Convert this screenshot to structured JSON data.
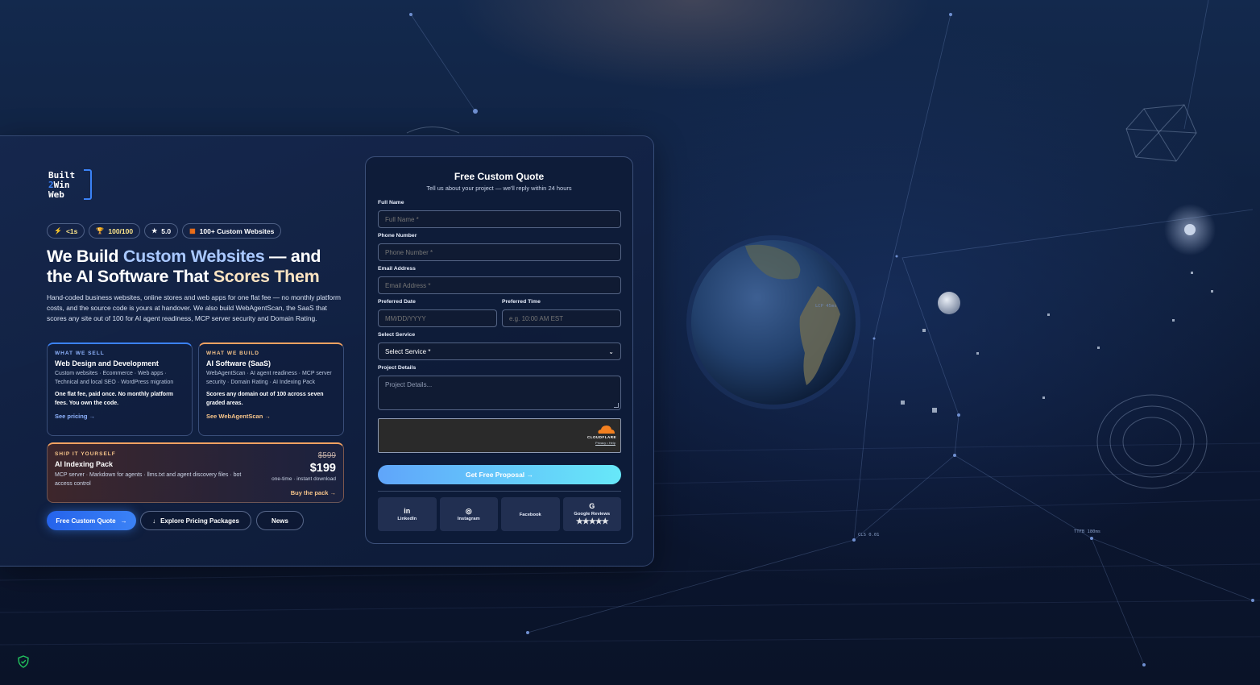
{
  "logo": {
    "line1": "Built",
    "line2_accent": "2",
    "line2": "Win",
    "line3": "Web"
  },
  "badges": [
    {
      "icon": "lightning-icon",
      "glyph": "⚡",
      "label": "<1s"
    },
    {
      "icon": "trophy-icon",
      "glyph": "🏆",
      "label": "100/100"
    },
    {
      "icon": "star-icon",
      "glyph": "★",
      "label": "5.0"
    },
    {
      "icon": "grid-icon",
      "glyph": "▦",
      "label": "100+ Custom Websites"
    }
  ],
  "headline": {
    "p1": "We Build ",
    "hl": "Custom Websites",
    "p2": " — and",
    "p3": "the AI Software That ",
    "p4": "Scores Them"
  },
  "lede": "Hand-coded business websites, online stores and web apps for one flat fee — no monthly platform costs, and the source code is yours at handover. We also build WebAgentScan, the SaaS that scores any site out of 100 for AI agent readiness, MCP server security and Domain Rating.",
  "cards": [
    {
      "eyebrow": "WHAT WE SELL",
      "title": "Web Design and Development",
      "sub": "Custom websites · Ecommerce · Web apps · Technical and local SEO · WordPress migration",
      "strong": "One flat fee, paid once. No monthly platform fees. You own the code.",
      "link": "See pricing →"
    },
    {
      "eyebrow": "WHAT WE BUILD",
      "title": "AI Software (SaaS)",
      "sub": "WebAgentScan · AI agent readiness · MCP server security · Domain Rating · AI Indexing Pack",
      "strong": "Scores any domain out of 100 across seven graded areas.",
      "link": "See WebAgentScan →"
    }
  ],
  "pack": {
    "eyebrow": "SHIP IT YOURSELF",
    "title": "AI Indexing Pack",
    "sub": "MCP server · Markdown for agents · llms.txt and agent discovery files · bot access control",
    "old_price": "$599",
    "price": "$199",
    "note": "one-time · instant download",
    "buy": "Buy the pack →"
  },
  "buttons": {
    "primary": "Free Custom Quote",
    "primary_arrow": "→",
    "pricing": "Explore Pricing Packages",
    "pricing_icon": "↓",
    "news": "News"
  },
  "form": {
    "title": "Free Custom Quote",
    "subtitle": "Tell us about your project — we'll reply within 24 hours",
    "full_name_label": "Full Name",
    "full_name_ph": "Full Name *",
    "phone_label": "Phone Number",
    "phone_ph": "Phone Number *",
    "email_label": "Email Address",
    "email_ph": "Email Address *",
    "date_label": "Preferred Date",
    "date_ph": "MM/DD/YYYY",
    "time_label": "Preferred Time",
    "time_ph": "e.g. 10:00 AM EST",
    "service_label": "Select Service",
    "service_value": "Select Service *",
    "details_label": "Project Details",
    "details_ph": "Project Details...",
    "captcha_brand": "CLOUDFLARE",
    "captcha_links": "Privacy • Help",
    "submit": "Get Free Proposal →"
  },
  "socials": [
    {
      "icon": "linkedin-icon",
      "glyph": "in",
      "label": "LinkedIn"
    },
    {
      "icon": "instagram-icon",
      "glyph": "◎",
      "label": "Instagram"
    },
    {
      "icon": "facebook-icon",
      "glyph": "",
      "label": "Facebook"
    },
    {
      "icon": "google-icon",
      "glyph": "G",
      "label": "Google Reviews",
      "stars": "★★★★★"
    }
  ],
  "hud": {
    "cls": "CLS 0.01",
    "ttfb": "TTFB 180ms",
    "lcp": "LCP 45ms"
  },
  "colors": {
    "accent": "#3b82f6",
    "warm": "#f4a261",
    "bg": "#0f1f3d"
  }
}
